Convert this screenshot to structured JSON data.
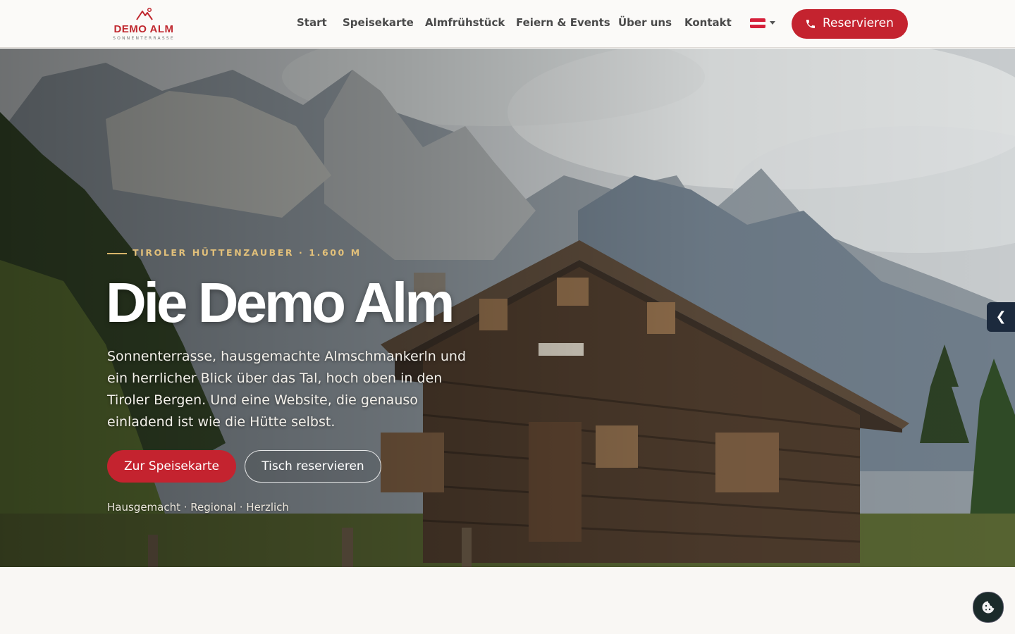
{
  "brand": {
    "name": "DEMO ALM",
    "subtitle": "SONNENTERRASSE",
    "accent": "#c4232f"
  },
  "nav": {
    "items": [
      {
        "label": "Start"
      },
      {
        "label": "Speisekarte"
      },
      {
        "label": "Almfrühstück"
      },
      {
        "label": "Feiern & Events"
      },
      {
        "label": "Über uns"
      },
      {
        "label": "Kontakt"
      }
    ],
    "language_icon": "austria-flag-icon",
    "reserve_label": "Reservieren",
    "reserve_icon": "phone-icon"
  },
  "hero": {
    "eyebrow": "TIROLER HÜTTENZAUBER · 1.600 M",
    "title": "Die Demo Alm",
    "lead": "Sonnenterrasse, hausgemachte Almschmankerln und ein herrlicher Blick über das Tal, hoch oben in den Tiroler Bergen. Und eine Website, die genauso einladend ist wie die Hütte selbst.",
    "primary_cta": "Zur Speisekarte",
    "secondary_cta": "Tisch reservieren",
    "tagline": "Hausgemacht · Regional · Herzlich"
  },
  "side_tab": {
    "label": "❮",
    "icon": "chevron-left-icon"
  },
  "cookie": {
    "icon": "cookie-icon"
  }
}
